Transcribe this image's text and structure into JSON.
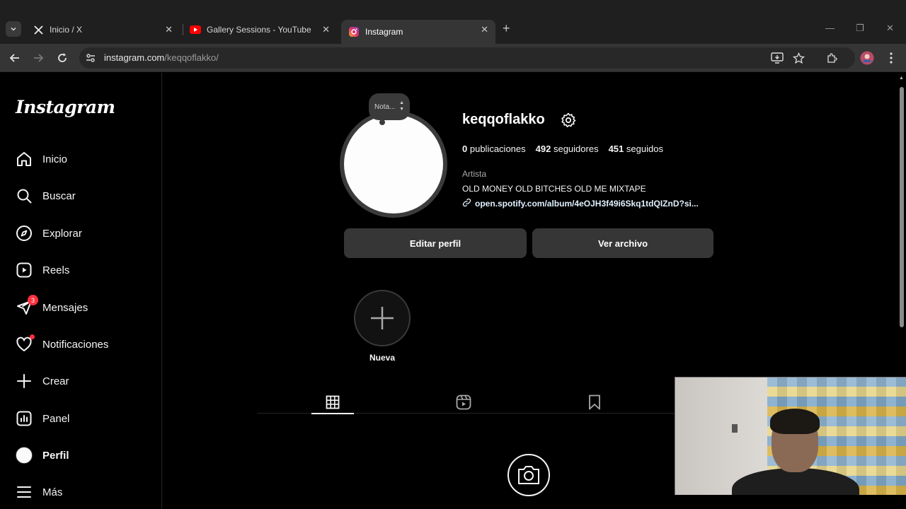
{
  "browser": {
    "tabs": [
      {
        "title": "Inicio / X",
        "icon": "x-logo-icon",
        "active": false
      },
      {
        "title": "Gallery Sessions - YouTube",
        "icon": "youtube-icon",
        "active": false
      },
      {
        "title": "Instagram",
        "icon": "instagram-icon",
        "active": true
      }
    ],
    "url_domain": "instagram.com",
    "url_path": "/keqqoflakko/"
  },
  "sidebar": {
    "logo": "Instagram",
    "items": [
      {
        "label": "Inicio",
        "icon": "home-icon"
      },
      {
        "label": "Buscar",
        "icon": "search-icon"
      },
      {
        "label": "Explorar",
        "icon": "compass-icon"
      },
      {
        "label": "Reels",
        "icon": "reels-icon"
      },
      {
        "label": "Mensajes",
        "icon": "messenger-icon",
        "badge": "3"
      },
      {
        "label": "Notificaciones",
        "icon": "heart-icon"
      },
      {
        "label": "Crear",
        "icon": "plus-icon"
      },
      {
        "label": "Panel",
        "icon": "dashboard-icon"
      },
      {
        "label": "Perfil",
        "icon": "avatar-icon"
      },
      {
        "label": "Más",
        "icon": "menu-icon"
      }
    ]
  },
  "profile": {
    "note": "Nota...",
    "username": "keqqoflakko",
    "stats": {
      "posts_count": "0",
      "posts_label": "publicaciones",
      "followers_count": "492",
      "followers_label": "seguidores",
      "following_count": "451",
      "following_label": "seguidos"
    },
    "category": "Artista",
    "bio": "OLD MONEY OLD BITCHES OLD ME MIXTAPE",
    "link": "open.spotify.com/album/4eOJH3f49i6Skq1tdQIZnD?si...",
    "edit_button": "Editar perfil",
    "archive_button": "Ver archivo",
    "new_highlight_label": "Nueva"
  },
  "colors": {
    "background": "#000000",
    "button": "#363636",
    "badge": "#ff3040",
    "browser_chrome": "#1f1f1f"
  }
}
